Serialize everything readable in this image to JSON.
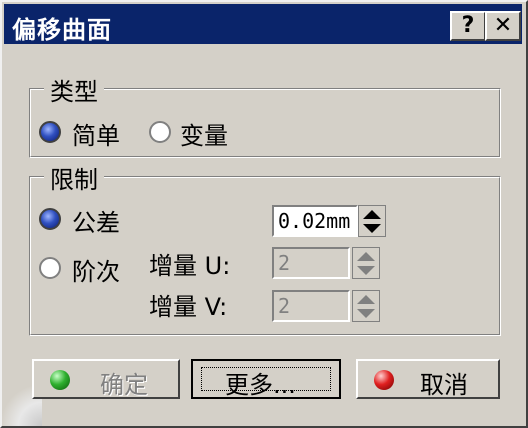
{
  "window": {
    "title": "偏移曲面",
    "help_label": "?",
    "close_label": "✕"
  },
  "type_group": {
    "legend": "类型",
    "options": [
      {
        "label": "简单",
        "checked": true
      },
      {
        "label": "变量",
        "checked": false
      }
    ]
  },
  "limit_group": {
    "legend": "限制",
    "tolerance_label": "公差",
    "tolerance_value": "0.02mm",
    "order_label": "阶次",
    "u_label": "增量 U:",
    "u_value": "2",
    "v_label": "增量 V:",
    "v_value": "2"
  },
  "buttons": {
    "ok": "确定",
    "more": "更多...",
    "cancel": "取消"
  },
  "icons": {
    "ok": "green-dot-icon",
    "cancel": "red-dot-icon",
    "spinner": "spin-arrows-icon"
  }
}
